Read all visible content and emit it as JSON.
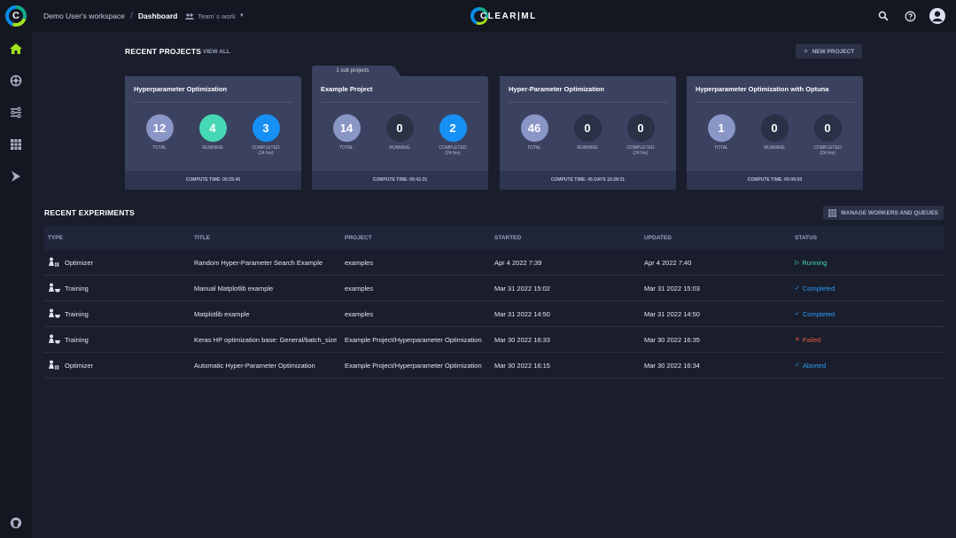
{
  "header": {
    "workspace": "Demo User's workspace",
    "separator": "/",
    "current_page": "Dashboard",
    "team_filter": "Team`s work",
    "brand": "CLEAR|ML"
  },
  "sidebar": {
    "items": [
      "home-icon",
      "projects-icon",
      "pipelines-icon",
      "datasets-icon",
      "workers-icon"
    ],
    "active": "home-icon"
  },
  "recent_projects": {
    "title": "RECENT PROJECTS",
    "view_all": "VIEW ALL",
    "new_project": "NEW PROJECT",
    "labels": {
      "total": "TOTAL",
      "running": "RUNNING",
      "completed": "COMPLETED",
      "completed_sub": "(24 hrs)"
    },
    "cards": [
      {
        "name": "Hyperparameter Optimization",
        "tab": "",
        "total": "12",
        "running": "4",
        "completed": "3",
        "compute_time": "COMPUTE TIME: 00:25:45"
      },
      {
        "name": "Example Project",
        "tab": "1 sub projects",
        "total": "14",
        "running": "0",
        "completed": "2",
        "compute_time": "COMPUTE TIME: 00:42:31"
      },
      {
        "name": "Hyper-Parameter Optimization",
        "tab": "",
        "total": "46",
        "running": "0",
        "completed": "0",
        "compute_time": "COMPUTE TIME: 45 DAYS 19:28:31"
      },
      {
        "name": "Hyperparameter Optimization with Optuna",
        "tab": "",
        "total": "1",
        "running": "0",
        "completed": "0",
        "compute_time": "COMPUTE TIME: 00:00:03"
      }
    ]
  },
  "recent_experiments": {
    "title": "RECENT EXPERIMENTS",
    "manage_button": "MANAGE WORKERS AND QUEUES",
    "columns": [
      "TYPE",
      "TITLE",
      "PROJECT",
      "STARTED",
      "UPDATED",
      "STATUS"
    ],
    "rows": [
      {
        "type": "Optimizer",
        "title": "Random Hyper-Parameter Search Example",
        "project": "examples",
        "started": "Apr 4 2022 7:39",
        "updated": "Apr 4 2022 7:40",
        "status": "Running",
        "status_icon": "▷"
      },
      {
        "type": "Training",
        "title": "Manual Matplotlib example",
        "project": "examples",
        "started": "Mar 31 2022 15:02",
        "updated": "Mar 31 2022 15:03",
        "status": "Completed",
        "status_icon": "✓"
      },
      {
        "type": "Training",
        "title": "Matplotlib example",
        "project": "examples",
        "started": "Mar 31 2022 14:50",
        "updated": "Mar 31 2022 14:50",
        "status": "Completed",
        "status_icon": "✓"
      },
      {
        "type": "Training",
        "title": "Keras HP optimization base: General/batch_size",
        "project": "Example Project/Hyperparameter Optimization",
        "started": "Mar 30 2022 16:33",
        "updated": "Mar 30 2022 16:35",
        "status": "Failed",
        "status_icon": "✕"
      },
      {
        "type": "Optimizer",
        "title": "Automatic Hyper-Parameter Optimization",
        "project": "Example Project/Hyperparameter Optimization",
        "started": "Mar 30 2022 16:15",
        "updated": "Mar 30 2022 16:34",
        "status": "Aborted",
        "status_icon": "✓"
      }
    ]
  },
  "colors": {
    "total": "#8a96c6",
    "running": "#46d8b4",
    "completed": "#1690f4",
    "failed": "#ee5a3c",
    "accent_home": "#a4e11e"
  }
}
